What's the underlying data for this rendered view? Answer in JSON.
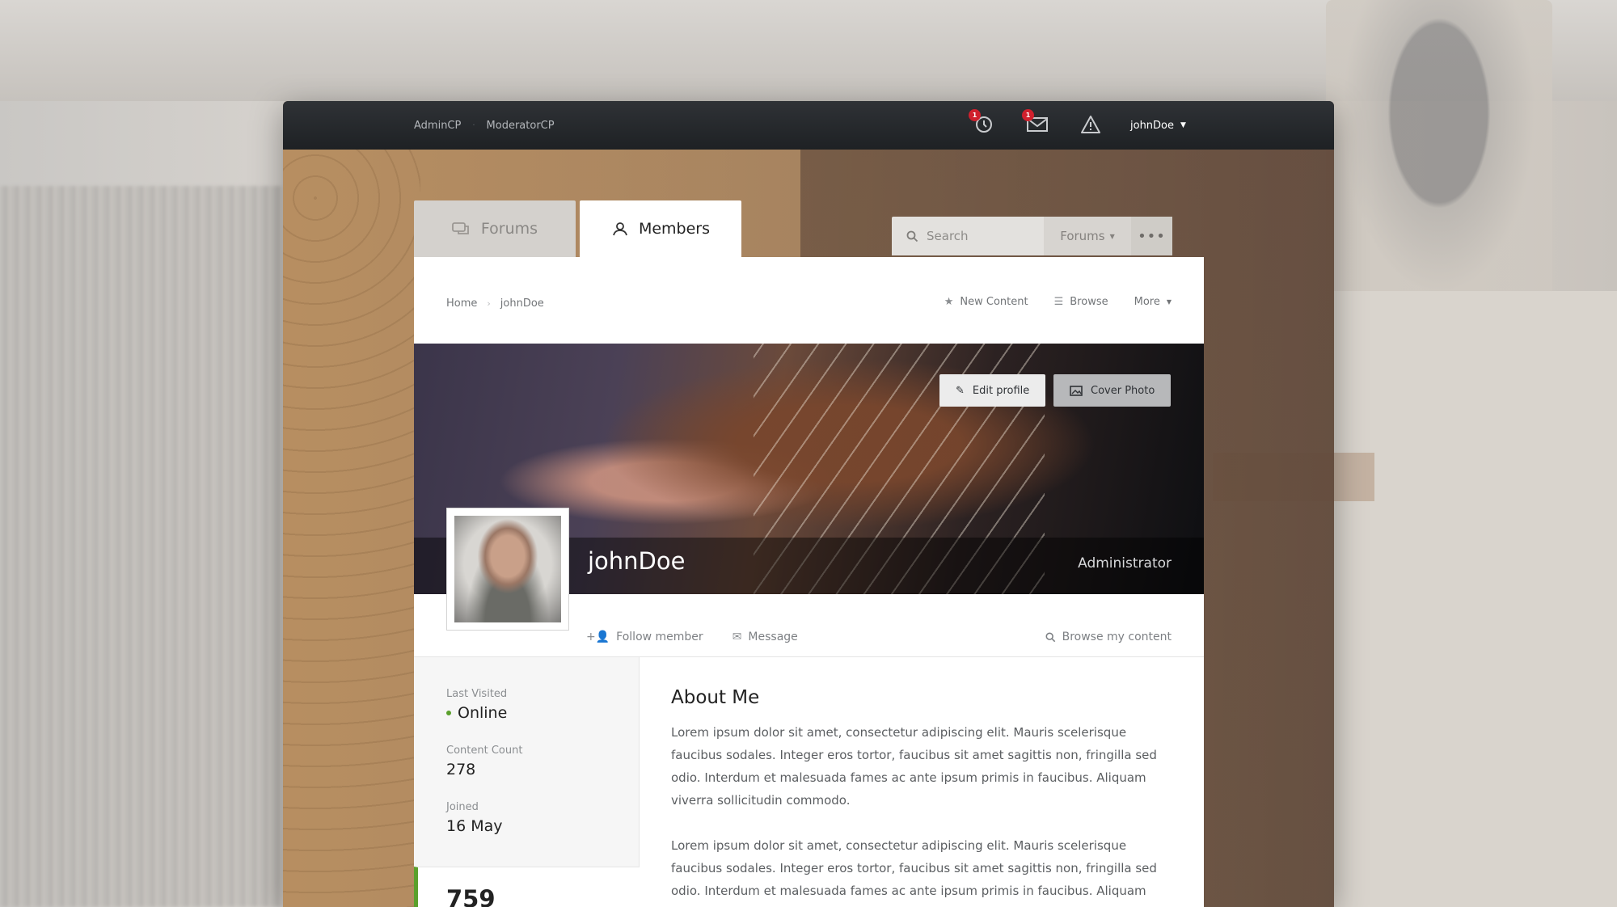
{
  "topbar": {
    "links": [
      "AdminCP",
      "ModeratorCP"
    ],
    "separator": "·",
    "notifications_badge": "1",
    "messages_badge": "1",
    "username": "johnDoe"
  },
  "tabs": [
    {
      "label": "Forums",
      "icon": "chat-bubbles-icon"
    },
    {
      "label": "Members",
      "icon": "members-icon"
    }
  ],
  "search": {
    "placeholder": "Search",
    "scope": "Forums",
    "more": "•••"
  },
  "breadcrumb": {
    "home": "Home",
    "current": "johnDoe"
  },
  "nav": {
    "new_content": "New Content",
    "browse": "Browse",
    "more": "More"
  },
  "cover": {
    "edit_profile": "Edit profile",
    "cover_photo": "Cover Photo",
    "name": "johnDoe",
    "role": "Administrator"
  },
  "actions": {
    "follow": "Follow member",
    "message": "Message",
    "browse_content": "Browse my content"
  },
  "stats": {
    "last_visited_label": "Last Visited",
    "last_visited_value": "Online",
    "content_count_label": "Content Count",
    "content_count_value": "278",
    "joined_label": "Joined",
    "joined_value": "16 May",
    "reputation_value": "759"
  },
  "about": {
    "title": "About Me",
    "paragraphs": [
      "Lorem ipsum dolor sit amet, consectetur adipiscing elit. Mauris scelerisque faucibus sodales. Integer eros tortor, faucibus sit amet sagittis non, fringilla sed odio. Interdum et malesuada fames ac ante ipsum primis in faucibus. Aliquam viverra sollicitudin commodo.",
      "Lorem ipsum dolor sit amet, consectetur adipiscing elit. Mauris scelerisque faucibus sodales. Integer eros tortor, faucibus sit amet sagittis non, fringilla sed odio. Interdum et malesuada fames ac ante ipsum primis in faucibus. Aliquam"
    ]
  },
  "colors": {
    "accent_green": "#5aa02c",
    "badge_red": "#d0202d",
    "topbar": "#23262a"
  }
}
